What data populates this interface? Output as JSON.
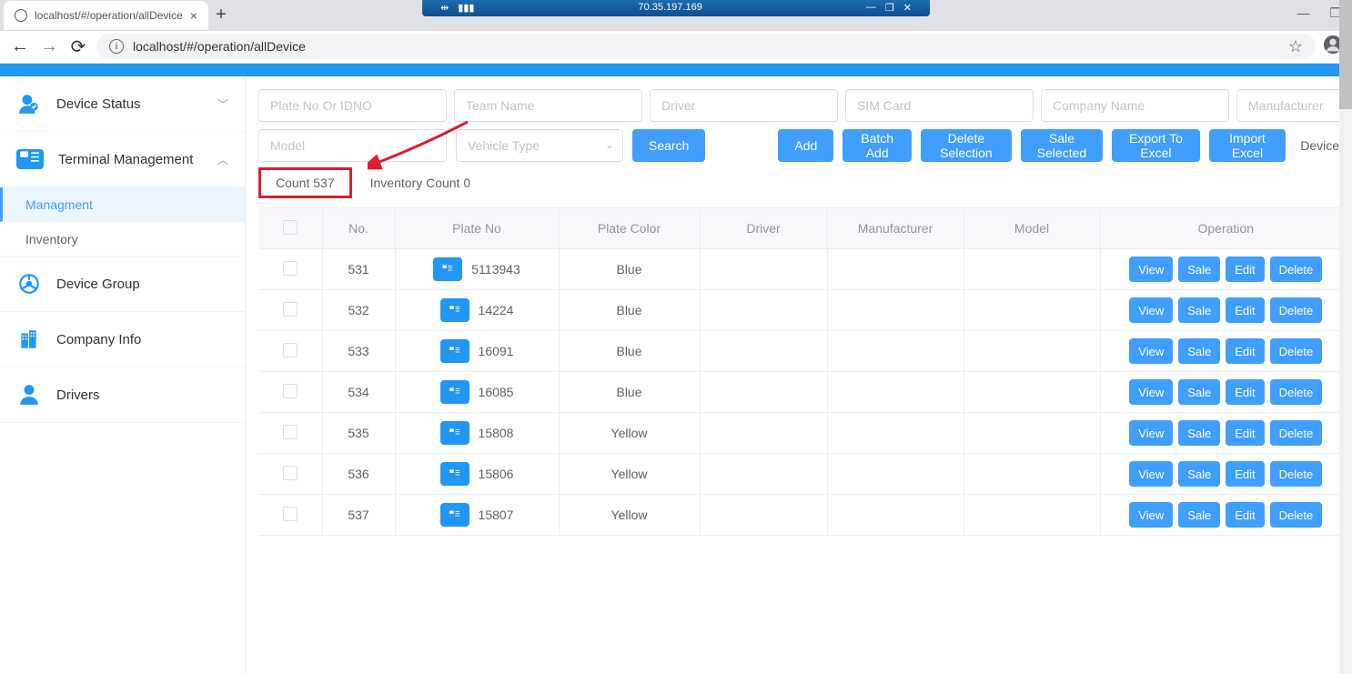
{
  "browser": {
    "tab_title": "localhost/#/operation/allDevice",
    "url": "localhost/#/operation/allDevice",
    "remote_ip": "70.35.197.169"
  },
  "sidebar": {
    "items": [
      {
        "label": "Device Status",
        "expandable": true,
        "expanded": false
      },
      {
        "label": "Terminal Management",
        "expandable": true,
        "expanded": true,
        "children": [
          {
            "label": "Managment",
            "active": true
          },
          {
            "label": "Inventory",
            "active": false
          }
        ]
      },
      {
        "label": "Device Group",
        "expandable": false
      },
      {
        "label": "Company Info",
        "expandable": false
      },
      {
        "label": "Drivers",
        "expandable": false
      }
    ]
  },
  "filters": {
    "plate_ph": "Plate No Or IDNO",
    "team_ph": "Team Name",
    "driver_ph": "Driver",
    "sim_ph": "SIM Card",
    "company_ph": "Company Name",
    "manufacturer_ph": "Manufacturer",
    "model_ph": "Model",
    "vehicle_type_ph": "Vehicle Type"
  },
  "actions": {
    "search": "Search",
    "add": "Add",
    "batch_add": "Batch Add",
    "delete_selection": "Delete Selection",
    "sale_selected": "Sale Selected",
    "export_excel": "Export To Excel",
    "import_excel": "Import Excel",
    "device_label": "Device"
  },
  "counts": {
    "count_label": "Count 537",
    "inventory_label": "Inventory Count 0"
  },
  "table": {
    "headers": {
      "no": "No.",
      "plate_no": "Plate No",
      "plate_color": "Plate Color",
      "driver": "Driver",
      "manufacturer": "Manufacturer",
      "model": "Model",
      "operation": "Operation"
    },
    "op_labels": {
      "view": "View",
      "sale": "Sale",
      "edit": "Edit",
      "delete": "Delete"
    },
    "rows": [
      {
        "no": "531",
        "plate": "5113943",
        "color": "Blue",
        "driver": "",
        "manu": "",
        "model": ""
      },
      {
        "no": "532",
        "plate": "14224",
        "color": "Blue",
        "driver": "",
        "manu": "",
        "model": ""
      },
      {
        "no": "533",
        "plate": "16091",
        "color": "Blue",
        "driver": "",
        "manu": "",
        "model": ""
      },
      {
        "no": "534",
        "plate": "16085",
        "color": "Blue",
        "driver": "",
        "manu": "",
        "model": ""
      },
      {
        "no": "535",
        "plate": "15808",
        "color": "Yellow",
        "driver": "",
        "manu": "",
        "model": ""
      },
      {
        "no": "536",
        "plate": "15806",
        "color": "Yellow",
        "driver": "",
        "manu": "",
        "model": ""
      },
      {
        "no": "537",
        "plate": "15807",
        "color": "Yellow",
        "driver": "",
        "manu": "",
        "model": ""
      }
    ]
  }
}
